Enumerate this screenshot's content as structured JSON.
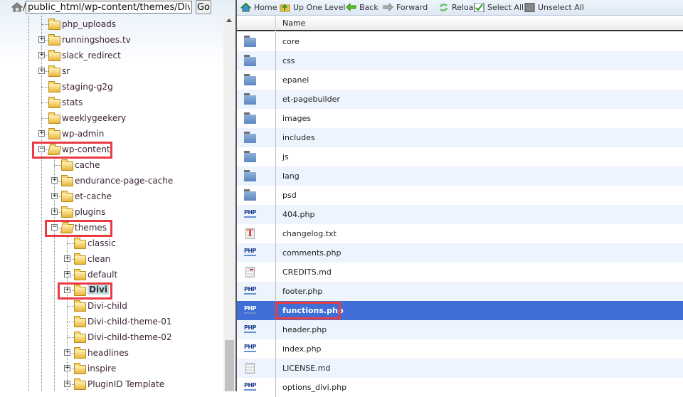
{
  "path_bar": {
    "separator": "/",
    "path": "public_html/wp-content/themes/Divi",
    "go_label": "Go"
  },
  "toolbar": [
    {
      "label": "Home",
      "icon": "home-icon"
    },
    {
      "label": "Up One Level",
      "icon": "up-folder-icon"
    },
    {
      "label": "Back",
      "icon": "back-arrow-icon"
    },
    {
      "label": "Forward",
      "icon": "forward-arrow-icon"
    },
    {
      "label": "Reload",
      "icon": "reload-icon"
    },
    {
      "label": "Select All",
      "icon": "checkbox-checked-icon"
    },
    {
      "label": "Unselect All",
      "icon": "checkbox-empty-icon"
    }
  ],
  "tree": [
    {
      "name": "php_uploads",
      "level": 1,
      "expander": "none"
    },
    {
      "name": "runningshoes.tv",
      "level": 1,
      "expander": "plus"
    },
    {
      "name": "slack_redirect",
      "level": 1,
      "expander": "plus"
    },
    {
      "name": "sr",
      "level": 1,
      "expander": "plus"
    },
    {
      "name": "staging-g2g",
      "level": 1,
      "expander": "none"
    },
    {
      "name": "stats",
      "level": 1,
      "expander": "none"
    },
    {
      "name": "weeklygeekery",
      "level": 1,
      "expander": "none"
    },
    {
      "name": "wp-admin",
      "level": 1,
      "expander": "plus"
    },
    {
      "name": "wp-content",
      "level": 1,
      "expander": "minus",
      "open": true,
      "highlighted": true
    },
    {
      "name": "cache",
      "level": 2,
      "expander": "none"
    },
    {
      "name": "endurance-page-cache",
      "level": 2,
      "expander": "plus"
    },
    {
      "name": "et-cache",
      "level": 2,
      "expander": "plus"
    },
    {
      "name": "plugins",
      "level": 2,
      "expander": "plus"
    },
    {
      "name": "themes",
      "level": 2,
      "expander": "minus",
      "open": true,
      "highlighted": true
    },
    {
      "name": "classic",
      "level": 3,
      "expander": "none"
    },
    {
      "name": "clean",
      "level": 3,
      "expander": "plus"
    },
    {
      "name": "default",
      "level": 3,
      "expander": "plus"
    },
    {
      "name": "Divi",
      "level": 3,
      "expander": "plus",
      "selected": true,
      "highlighted": true
    },
    {
      "name": "Divi-child",
      "level": 3,
      "expander": "none"
    },
    {
      "name": "Divi-child-theme-01",
      "level": 3,
      "expander": "none"
    },
    {
      "name": "Divi-child-theme-02",
      "level": 3,
      "expander": "none"
    },
    {
      "name": "headlines",
      "level": 3,
      "expander": "plus"
    },
    {
      "name": "inspire",
      "level": 3,
      "expander": "plus"
    },
    {
      "name": "PluginID Template",
      "level": 3,
      "expander": "plus"
    }
  ],
  "file_list": {
    "column_name": "Name",
    "files": [
      {
        "name": "core",
        "type": "folder"
      },
      {
        "name": "css",
        "type": "folder"
      },
      {
        "name": "epanel",
        "type": "folder"
      },
      {
        "name": "et-pagebuilder",
        "type": "folder"
      },
      {
        "name": "images",
        "type": "folder"
      },
      {
        "name": "includes",
        "type": "folder"
      },
      {
        "name": "js",
        "type": "folder"
      },
      {
        "name": "lang",
        "type": "folder"
      },
      {
        "name": "psd",
        "type": "folder"
      },
      {
        "name": "404.php",
        "type": "php"
      },
      {
        "name": "changelog.txt",
        "type": "txt"
      },
      {
        "name": "comments.php",
        "type": "php"
      },
      {
        "name": "CREDITS.md",
        "type": "md-red"
      },
      {
        "name": "footer.php",
        "type": "php"
      },
      {
        "name": "functions.php",
        "type": "php",
        "selected": true,
        "highlighted": true
      },
      {
        "name": "header.php",
        "type": "php"
      },
      {
        "name": "index.php",
        "type": "php"
      },
      {
        "name": "LICENSE.md",
        "type": "md"
      },
      {
        "name": "options_divi.php",
        "type": "php"
      }
    ]
  },
  "colors": {
    "highlight_box": "#ea3b45",
    "selected_row": "#3f6fd6",
    "alt_row": "#edf4fd"
  }
}
